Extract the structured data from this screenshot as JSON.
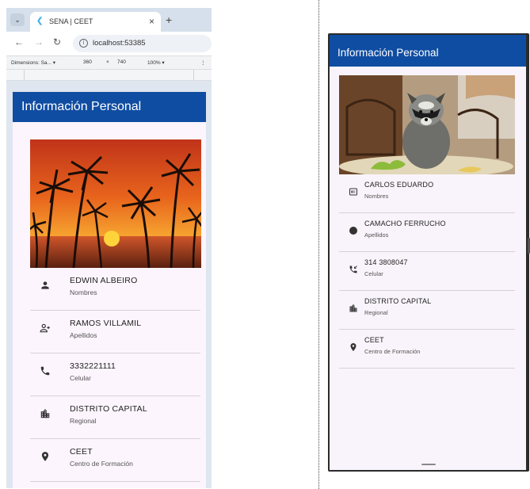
{
  "browser": {
    "tab_title": "SENA | CEET",
    "new_tab_label": "+",
    "close_label": "×",
    "url": "localhost:53385",
    "devtools": {
      "device": "Dimensions: Sa...",
      "width": "360",
      "times": "×",
      "height": "740",
      "zoom": "100%"
    }
  },
  "web_app": {
    "title": "Información Personal",
    "items": [
      {
        "value": "EDWIN ALBEIRO",
        "label": "Nombres",
        "icon": "person-icon"
      },
      {
        "value": "RAMOS VILLAMIL",
        "label": "Apellidos",
        "icon": "person-add-icon"
      },
      {
        "value": "3332221111",
        "label": "Celular",
        "icon": "phone-icon"
      },
      {
        "value": "DISTRITO CAPITAL",
        "label": "Regional",
        "icon": "location-city-icon"
      },
      {
        "value": "CEET",
        "label": "Centro de Formación",
        "icon": "location-pin-icon"
      }
    ]
  },
  "mobile_app": {
    "title": "Información Personal",
    "items": [
      {
        "value": "CARLOS EDUARDO",
        "label": "Nombres",
        "icon": "badge-icon"
      },
      {
        "value": "CAMACHO FERRUCHO",
        "label": "Apellidos",
        "icon": "circle-icon"
      },
      {
        "value": "314 3808047",
        "label": "Celular",
        "icon": "phone-callback-icon"
      },
      {
        "value": "DISTRITO CAPITAL",
        "label": "Regional",
        "icon": "location-city-icon"
      },
      {
        "value": "CEET",
        "label": "Centro de Formación",
        "icon": "location-pin-icon"
      }
    ]
  },
  "colors": {
    "appbar": "#0f4da2",
    "background": "#fcf5fd"
  }
}
